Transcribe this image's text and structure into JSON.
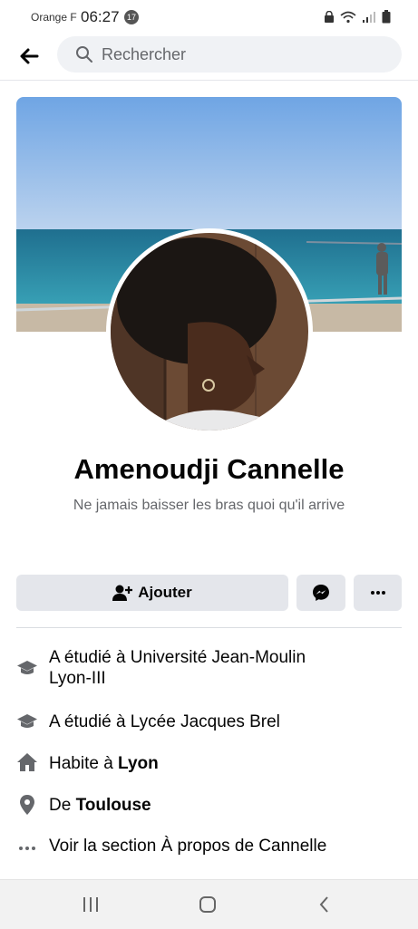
{
  "status": {
    "carrier": "Orange F",
    "time": "06:27",
    "badge": "17"
  },
  "search": {
    "placeholder": "Rechercher"
  },
  "profile": {
    "name": "Amenoudji Cannelle",
    "bio": "Ne jamais baisser les bras quoi qu'il arrive"
  },
  "actions": {
    "add_label": "Ajouter"
  },
  "about": {
    "education_1_line1": "A étudié à Université Jean-Moulin",
    "education_1_line2": "Lyon-III",
    "education_2": "A étudié à Lycée Jacques Brel",
    "lives_prefix": "Habite à ",
    "lives_city": "Lyon",
    "from_prefix": "De ",
    "from_city": "Toulouse",
    "see_about": "Voir la section À propos de Cannelle"
  },
  "icons": {
    "back": "arrow-left-icon",
    "search": "search-icon",
    "add_friend": "person-plus-icon",
    "messenger": "messenger-icon",
    "more": "more-horizontal-icon",
    "education": "graduation-cap-icon",
    "home": "home-icon",
    "location": "location-pin-icon",
    "ellipsis": "ellipsis-icon"
  }
}
